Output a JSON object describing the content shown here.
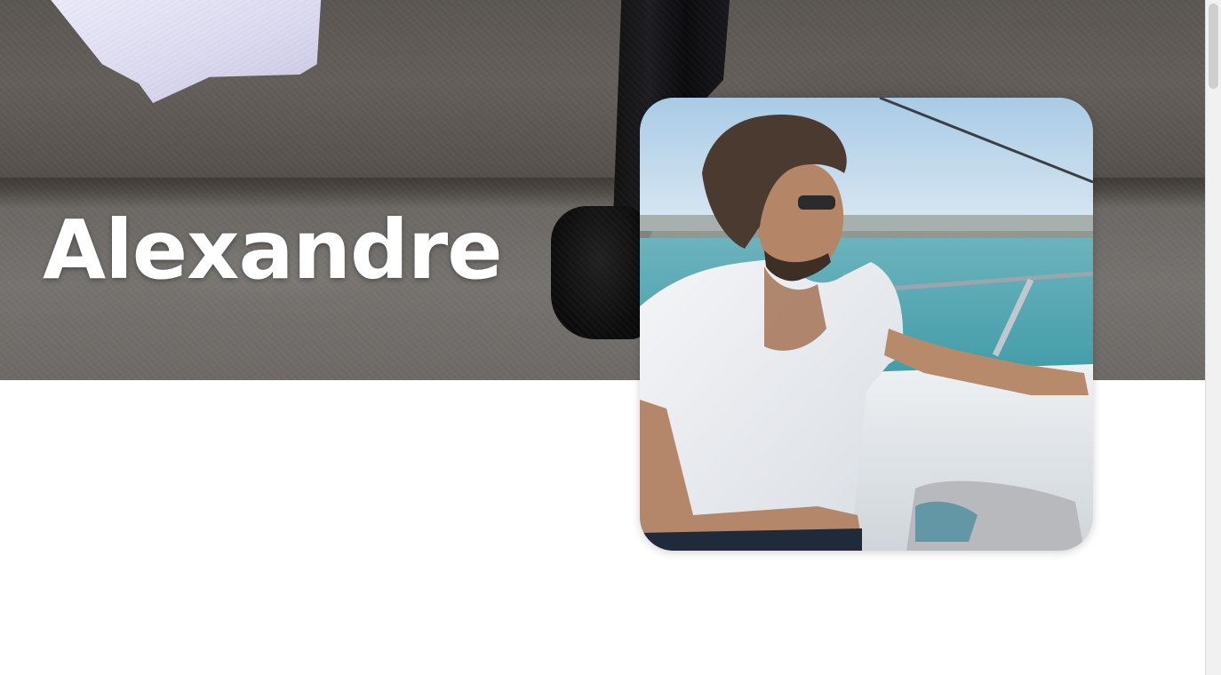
{
  "profile": {
    "name": "Alexandre"
  },
  "colors": {
    "cover_base": "#635e59",
    "name_text": "#ffffff",
    "page_background": "#ffffff"
  },
  "icons": {
    "avatar": "profile-photo",
    "cover": "cover-photo"
  }
}
